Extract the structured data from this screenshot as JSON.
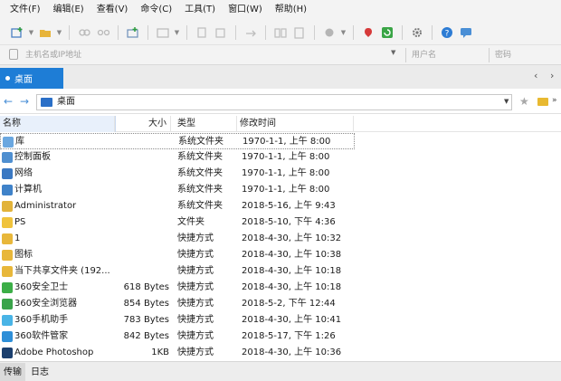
{
  "menu": {
    "items": [
      {
        "label": "文件(F)"
      },
      {
        "label": "编辑(E)"
      },
      {
        "label": "查看(V)"
      },
      {
        "label": "命令(C)"
      },
      {
        "label": "工具(T)"
      },
      {
        "label": "窗口(W)"
      },
      {
        "label": "帮助(H)"
      }
    ]
  },
  "connection": {
    "host_placeholder": "主机名或IP地址",
    "user_placeholder": "用户名",
    "password_placeholder": "密码"
  },
  "tabs": {
    "active_label": "桌面"
  },
  "address": {
    "path": "桌面"
  },
  "columns": {
    "name": "名称",
    "size": "大小",
    "type": "类型",
    "mtime": "修改时间"
  },
  "files": [
    {
      "name": "库",
      "size": "",
      "type": "系统文件夹",
      "mtime": "1970-1-1, 上午 8:00",
      "icon": "library-icon",
      "color": "#6aa7e0"
    },
    {
      "name": "控制面板",
      "size": "",
      "type": "系统文件夹",
      "mtime": "1970-1-1, 上午 8:00",
      "icon": "control-panel-icon",
      "color": "#4f8fd0"
    },
    {
      "name": "网络",
      "size": "",
      "type": "系统文件夹",
      "mtime": "1970-1-1, 上午 8:00",
      "icon": "network-icon",
      "color": "#3a78c2"
    },
    {
      "name": "计算机",
      "size": "",
      "type": "系统文件夹",
      "mtime": "1970-1-1, 上午 8:00",
      "icon": "computer-icon",
      "color": "#3f82c9"
    },
    {
      "name": "Administrator",
      "size": "",
      "type": "系统文件夹",
      "mtime": "2018-5-16, 上午 9:43",
      "icon": "user-folder-icon",
      "color": "#e2b33a"
    },
    {
      "name": "PS",
      "size": "",
      "type": "文件夹",
      "mtime": "2018-5-10, 下午 4:36",
      "icon": "folder-icon",
      "color": "#f0c33c"
    },
    {
      "name": "1",
      "size": "",
      "type": "快捷方式",
      "mtime": "2018-4-30, 上午 10:32",
      "icon": "shortcut-icon",
      "color": "#e8b73a"
    },
    {
      "name": "图标",
      "size": "",
      "type": "快捷方式",
      "mtime": "2018-4-30, 上午 10:38",
      "icon": "shortcut-icon",
      "color": "#e8b73a"
    },
    {
      "name": "当下共享文件夹 (192...",
      "size": "",
      "type": "快捷方式",
      "mtime": "2018-4-30, 上午 10:18",
      "icon": "shared-folder-icon",
      "color": "#e8b73a"
    },
    {
      "name": "360安全卫士",
      "size": "618 Bytes",
      "type": "快捷方式",
      "mtime": "2018-4-30, 上午 10:18",
      "icon": "app-360-security-icon",
      "color": "#3cae47"
    },
    {
      "name": "360安全浏览器",
      "size": "854 Bytes",
      "type": "快捷方式",
      "mtime": "2018-5-2, 下午 12:44",
      "icon": "app-360-browser-icon",
      "color": "#3aa34a"
    },
    {
      "name": "360手机助手",
      "size": "783 Bytes",
      "type": "快捷方式",
      "mtime": "2018-4-30, 上午 10:41",
      "icon": "app-360-phone-icon",
      "color": "#49b4e6"
    },
    {
      "name": "360软件管家",
      "size": "842 Bytes",
      "type": "快捷方式",
      "mtime": "2018-5-17, 下午 1:26",
      "icon": "app-360-software-icon",
      "color": "#2e8fd8"
    },
    {
      "name": "Adobe Photoshop",
      "size": "1KB",
      "type": "快捷方式",
      "mtime": "2018-4-30, 上午 10:36",
      "icon": "app-photoshop-icon",
      "color": "#1b3f6e"
    }
  ],
  "status": {
    "tab_transfer": "传输",
    "tab_log": "日志"
  }
}
